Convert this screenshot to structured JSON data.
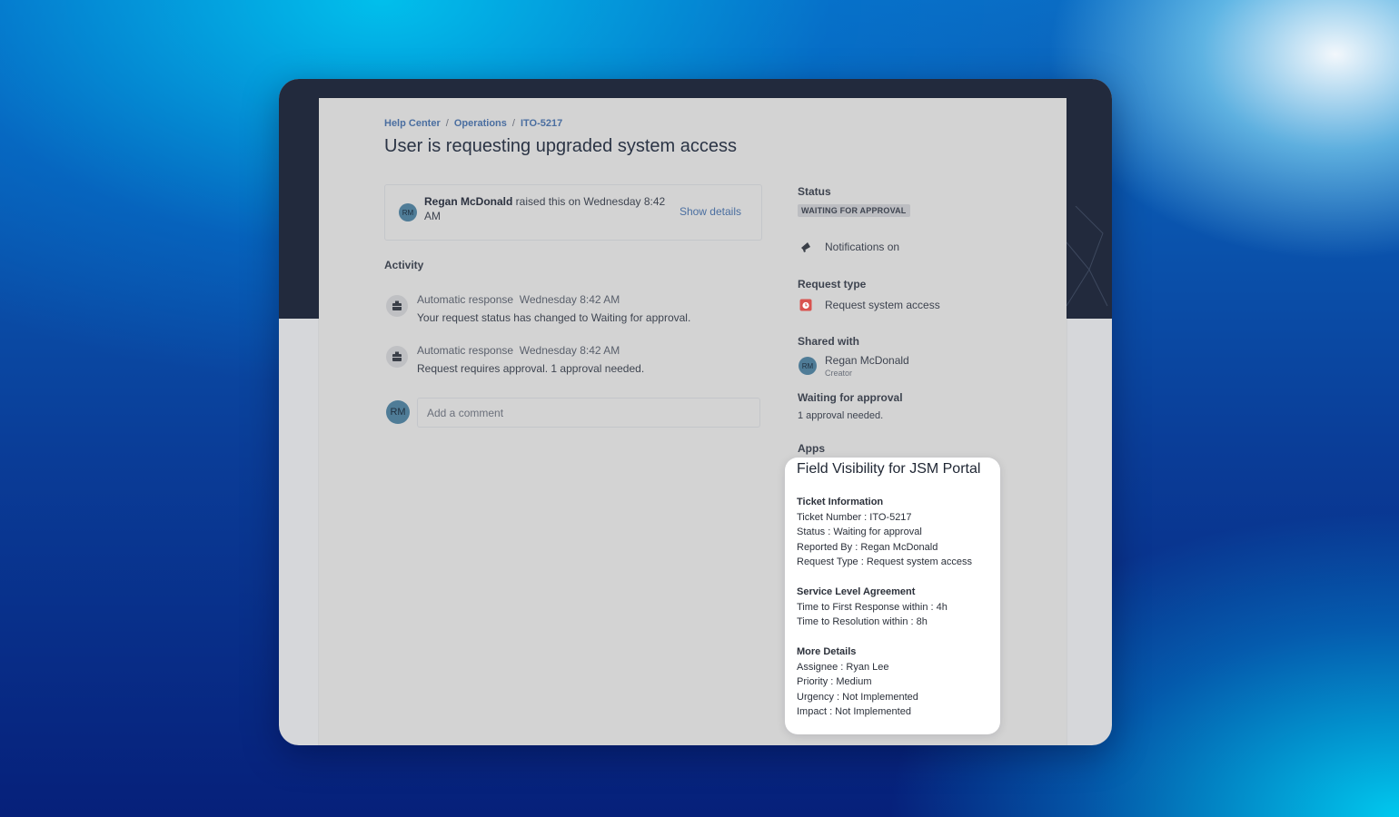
{
  "breadcrumb": {
    "items": [
      "Help Center",
      "Operations",
      "ITO-5217"
    ],
    "separator": "/"
  },
  "page_title": "User is requesting upgraded system access",
  "raised": {
    "avatar_initials": "RM",
    "name": "Regan McDonald",
    "text": " raised this on Wednesday 8:42 AM",
    "show_details_label": "Show details"
  },
  "activity": {
    "label": "Activity",
    "items": [
      {
        "author": "Automatic response",
        "time": "Wednesday 8:42 AM",
        "message": "Your request status has changed to Waiting for approval."
      },
      {
        "author": "Automatic response",
        "time": "Wednesday 8:42 AM",
        "message": "Request requires approval. 1 approval needed."
      }
    ],
    "comment_avatar_initials": "RM",
    "comment_placeholder": "Add a comment"
  },
  "sidebar": {
    "status_label": "Status",
    "status_value": "WAITING FOR APPROVAL",
    "notifications_label": "Notifications on",
    "request_type_label": "Request type",
    "request_type_value": "Request system access",
    "shared_with_label": "Shared with",
    "shared_avatar_initials": "RM",
    "shared_name": "Regan McDonald",
    "shared_role": "Creator",
    "waiting_label": "Waiting for approval",
    "waiting_value": "1 approval needed.",
    "apps_label": "Apps"
  },
  "apps_card": {
    "title": "Field Visibility for JSM Portal",
    "ticket_info": {
      "heading": "Ticket Information",
      "lines": [
        "Ticket Number : ITO-5217",
        "Status : Waiting for approval",
        "Reported By : Regan McDonald",
        "Request Type : Request system access"
      ]
    },
    "sla": {
      "heading": "Service Level Agreement",
      "lines": [
        "Time to First Response within : 4h",
        "Time to Resolution within : 8h"
      ]
    },
    "more": {
      "heading": "More Details",
      "lines": [
        "Assignee : Ryan Lee",
        "Priority : Medium",
        "Urgency : Not Implemented",
        "Impact : Not Implemented"
      ]
    }
  },
  "colors": {
    "link": "#4a6ea0",
    "dark_header": "#222a3d",
    "page_bg": "#d3d3d3",
    "avatar": "#4f7c97",
    "request_icon": "#d9534f"
  },
  "icons": [
    "bot-icon",
    "megaphone-icon",
    "request-type-icon"
  ]
}
